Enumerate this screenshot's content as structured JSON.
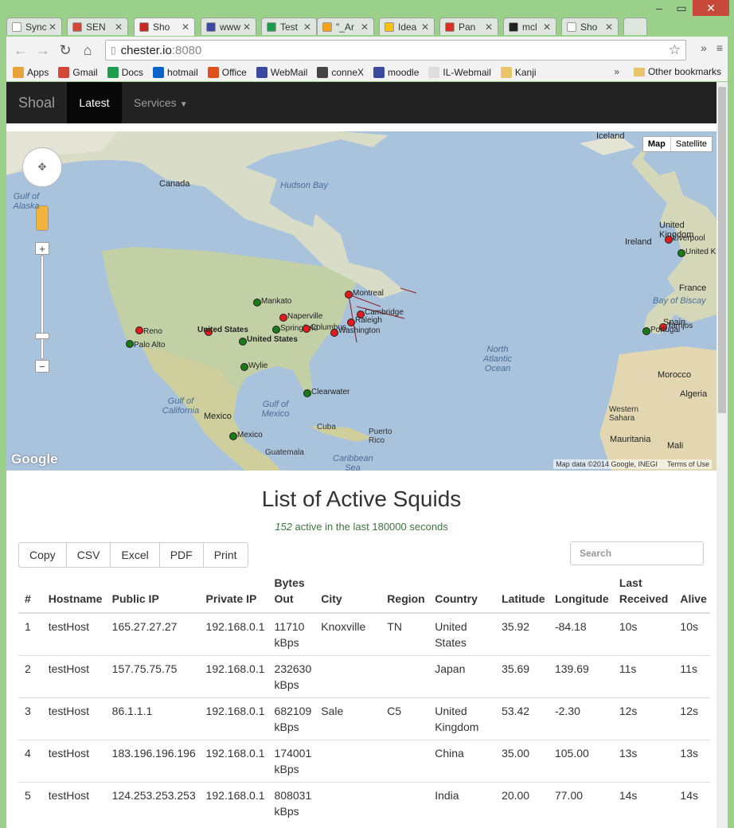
{
  "browser": {
    "tabs": [
      {
        "label": "Sync",
        "icon_color": "#ffffff"
      },
      {
        "label": "SEN",
        "icon_color": "#d44638"
      },
      {
        "label": "Sho",
        "icon_color": "#c62828"
      },
      {
        "label": "www",
        "icon_color": "#3b4a9e"
      },
      {
        "label": "Test",
        "icon_color": "#1e9b4f"
      },
      {
        "label": "\"_Ar",
        "icon_color": "#f4a11b"
      },
      {
        "label": "Idea",
        "icon_color": "#f4c20d"
      },
      {
        "label": "Pan",
        "icon_color": "#d93025"
      },
      {
        "label": "mcl",
        "icon_color": "#222222"
      },
      {
        "label": "Sho",
        "icon_color": "#ffffff"
      }
    ],
    "url_host": "chester.io",
    "url_port": ":8080",
    "bookmarks": [
      {
        "label": "Apps",
        "icon": "apps-icon"
      },
      {
        "label": "Gmail",
        "icon": "gmail-icon"
      },
      {
        "label": "Docs",
        "icon": "drive-icon"
      },
      {
        "label": "hotmail",
        "icon": "outlook-icon"
      },
      {
        "label": "Office",
        "icon": "office-icon"
      },
      {
        "label": "WebMail",
        "icon": "shield-icon"
      },
      {
        "label": "conneX",
        "icon": "connex-icon"
      },
      {
        "label": "moodle",
        "icon": "shield-icon"
      },
      {
        "label": "IL-Webmail",
        "icon": "page-icon"
      },
      {
        "label": "Kanji",
        "icon": "folder-icon"
      }
    ],
    "bookmarks_overflow": "»",
    "other_bookmarks": "Other bookmarks"
  },
  "navbar": {
    "brand": "Shoal",
    "active": "Latest",
    "services": "Services"
  },
  "map": {
    "maptype_map": "Map",
    "maptype_satellite": "Satellite",
    "logo": "Google",
    "attribution": "Map data ©2014 Google, INEGI",
    "terms": "Terms of Use",
    "labels": {
      "iceland": "Iceland",
      "canada": "Canada",
      "hudson": "Hudson Bay",
      "gulf_alaska": "Gulf of Alaska",
      "uk": "United Kingdom",
      "ireland": "Ireland",
      "france": "France",
      "biscay": "Bay of Biscay",
      "portugal": "Portugal",
      "spain": "Spain",
      "morocco": "Morocco",
      "algeria": "Algeria",
      "wsahara": "Western Sahara",
      "mauritania": "Mauritania",
      "mali": "Mali",
      "north_atlantic": "North Atlantic Ocean",
      "gulf_california": "Gulf of California",
      "gulf_mexico": "Gulf of Mexico",
      "mexico": "Mexico",
      "cuba": "Cuba",
      "puerto_rico": "Puerto Rico",
      "caribbean": "Caribbean Sea",
      "guatemala": "Guatemala",
      "us": "United States"
    },
    "markers": [
      {
        "label": "Reno",
        "color": "red"
      },
      {
        "label": "Palo Alto",
        "color": "green"
      },
      {
        "label": "United States",
        "color": "red"
      },
      {
        "label": "United States",
        "color": "green"
      },
      {
        "label": "Mankato",
        "color": "green"
      },
      {
        "label": "Springfield",
        "color": "green"
      },
      {
        "label": "Naperville",
        "color": "red"
      },
      {
        "label": "Columbus",
        "color": "red"
      },
      {
        "label": "Montreal",
        "color": "red"
      },
      {
        "label": "Cambridge",
        "color": "red"
      },
      {
        "label": "Raleigh",
        "color": "red"
      },
      {
        "label": "Washington",
        "color": "red"
      },
      {
        "label": "Wylie",
        "color": "green"
      },
      {
        "label": "Clearwater",
        "color": "green"
      },
      {
        "label": "Mexico",
        "color": "green"
      },
      {
        "label": "Liverpool",
        "color": "red"
      },
      {
        "label": "United Kingdom",
        "color": "green"
      },
      {
        "label": "Tarrijos",
        "color": "red"
      },
      {
        "label": "Portugal",
        "color": "green"
      }
    ]
  },
  "page": {
    "title": "List of Active Squids",
    "sub_count": "152",
    "sub_text": " active in the last 180000 seconds",
    "buttons": [
      "Copy",
      "CSV",
      "Excel",
      "PDF",
      "Print"
    ],
    "search_placeholder": "Search"
  },
  "table": {
    "headers": [
      "#",
      "Hostname",
      "Public IP",
      "Private IP",
      "Bytes Out",
      "City",
      "Region",
      "Country",
      "Latitude",
      "Longitude",
      "Last Received",
      "Alive"
    ],
    "rows": [
      [
        "1",
        "testHost",
        "165.27.27.27",
        "192.168.0.1",
        "11710 kBps",
        "Knoxville",
        "TN",
        "United States",
        "35.92",
        "-84.18",
        "10s",
        "10s"
      ],
      [
        "2",
        "testHost",
        "157.75.75.75",
        "192.168.0.1",
        "232630 kBps",
        "",
        "",
        "Japan",
        "35.69",
        "139.69",
        "11s",
        "11s"
      ],
      [
        "3",
        "testHost",
        "86.1.1.1",
        "192.168.0.1",
        "682109 kBps",
        "Sale",
        "C5",
        "United Kingdom",
        "53.42",
        "-2.30",
        "12s",
        "12s"
      ],
      [
        "4",
        "testHost",
        "183.196.196.196",
        "192.168.0.1",
        "174001 kBps",
        "",
        "",
        "China",
        "35.00",
        "105.00",
        "13s",
        "13s"
      ],
      [
        "5",
        "testHost",
        "124.253.253.253",
        "192.168.0.1",
        "808031 kBps",
        "",
        "",
        "India",
        "20.00",
        "77.00",
        "14s",
        "14s"
      ]
    ]
  }
}
